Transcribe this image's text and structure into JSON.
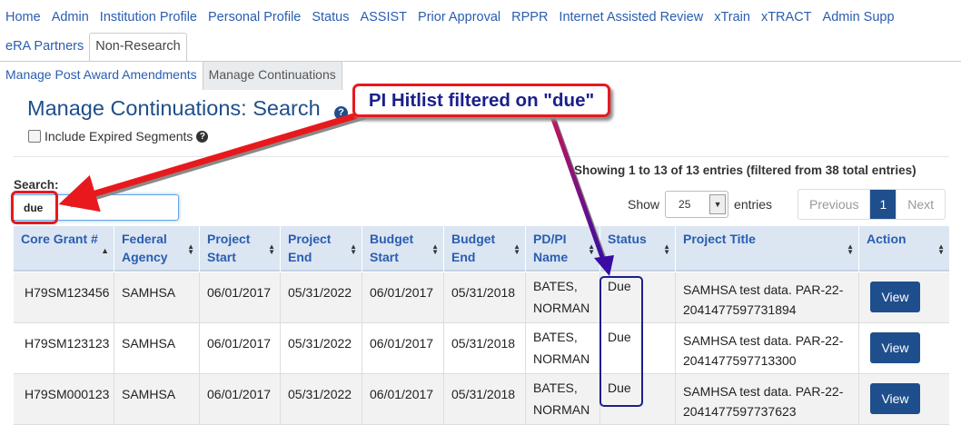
{
  "nav": {
    "row1": [
      "Home",
      "Admin",
      "Institution Profile",
      "Personal Profile",
      "Status",
      "ASSIST",
      "Prior Approval",
      "RPPR",
      "Internet Assisted Review",
      "xTrain",
      "xTRACT",
      "Admin Supp"
    ],
    "row2": [
      "eRA Partners",
      "Non-Research"
    ],
    "active": "Non-Research"
  },
  "subnav": {
    "items": [
      "Manage Post Award Amendments",
      "Manage Continuations"
    ],
    "active": "Manage Continuations"
  },
  "page": {
    "title": "Manage Continuations: Search",
    "help_icon": "?",
    "include_expired_label": "Include Expired Segments"
  },
  "search": {
    "label": "Search:",
    "value": "due"
  },
  "info": {
    "showing": "Showing 1 to 13 of 13 entries (filtered from 38 total entries)"
  },
  "length": {
    "show_label": "Show",
    "value": "25",
    "entries_label": "entries"
  },
  "pager": {
    "previous": "Previous",
    "current": "1",
    "next": "Next"
  },
  "table": {
    "headers": [
      "Core Grant #",
      "Federal Agency",
      "Project Start",
      "Project End",
      "Budget Start",
      "Budget End",
      "PD/PI Name",
      "Status",
      "Project Title",
      "Action"
    ],
    "rows": [
      {
        "grant": "H79SM123456",
        "agency": "SAMHSA",
        "pstart": "06/01/2017",
        "pend": "05/31/2022",
        "bstart": "06/01/2017",
        "bend": "05/31/2018",
        "pi": "BATES, NORMAN",
        "status": "Due",
        "title": "SAMHSA test data. PAR-22-2041477597731894",
        "action": "View"
      },
      {
        "grant": "H79SM123123",
        "agency": "SAMHSA",
        "pstart": "06/01/2017",
        "pend": "05/31/2022",
        "bstart": "06/01/2017",
        "bend": "05/31/2018",
        "pi": "BATES, NORMAN",
        "status": "Due",
        "title": "SAMHSA test data. PAR-22-2041477597713300",
        "action": "View"
      },
      {
        "grant": "H79SM000123",
        "agency": "SAMHSA",
        "pstart": "06/01/2017",
        "pend": "05/31/2022",
        "bstart": "06/01/2017",
        "bend": "05/31/2018",
        "pi": "BATES, NORMAN",
        "status": "Due",
        "title": "SAMHSA test data. PAR-22-2041477597737623",
        "action": "View"
      }
    ]
  },
  "annotation": {
    "callout": "PI Hitlist filtered on \"due\""
  }
}
